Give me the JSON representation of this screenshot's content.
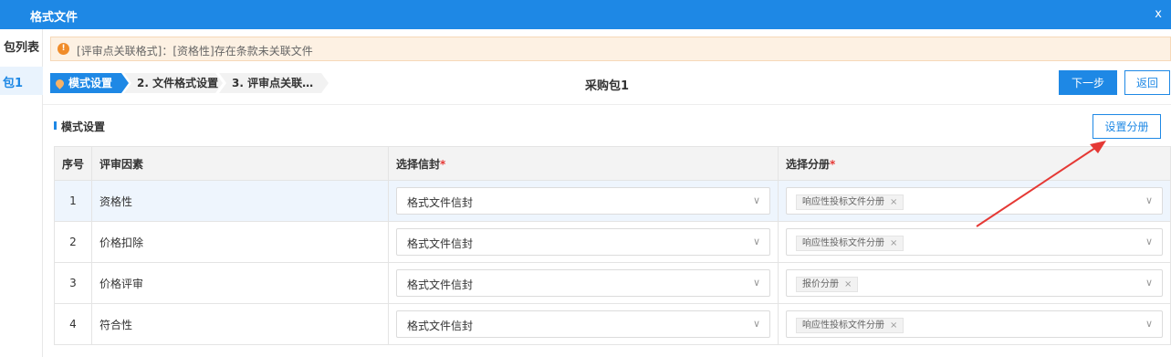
{
  "window": {
    "title": "格式文件",
    "close": "x"
  },
  "sidebar": {
    "header": "包列表",
    "items": [
      {
        "label": "包1"
      }
    ]
  },
  "alert": {
    "icon": "!",
    "text": "[评审点关联格式]：[资格性]存在条款未关联文件"
  },
  "steps": [
    {
      "label": "模式设置",
      "active": true
    },
    {
      "label": "2. 文件格式设置"
    },
    {
      "label": "3. 评审点关联…"
    }
  ],
  "package_title": "采购包1",
  "buttons": {
    "next": "下一步",
    "back": "返回",
    "set_volumes": "设置分册"
  },
  "section": {
    "title": "模式设置"
  },
  "table": {
    "headers": {
      "index": "序号",
      "factor": "评审因素",
      "envelope": "选择信封",
      "volume": "选择分册",
      "required_mark": "*"
    },
    "rows": [
      {
        "index": "1",
        "factor": "资格性",
        "envelope": "格式文件信封",
        "volume_tag": "响应性投标文件分册",
        "selected": true
      },
      {
        "index": "2",
        "factor": "价格扣除",
        "envelope": "格式文件信封",
        "volume_tag": "响应性投标文件分册"
      },
      {
        "index": "3",
        "factor": "价格评审",
        "envelope": "格式文件信封",
        "volume_tag": "报价分册"
      },
      {
        "index": "4",
        "factor": "符合性",
        "envelope": "格式文件信封",
        "volume_tag": "响应性投标文件分册"
      }
    ],
    "tag_remove": "×",
    "dropdown_icon": "chevron-down-icon"
  },
  "colors": {
    "primary": "#1e88e5",
    "warning": "#f08c2a",
    "annotation_arrow": "#e53935"
  }
}
